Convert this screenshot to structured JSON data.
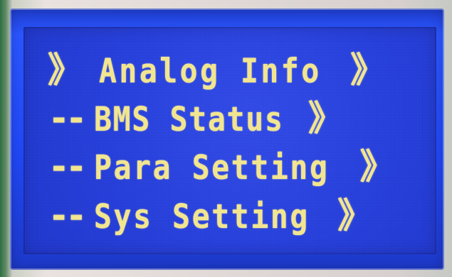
{
  "menu": {
    "items": [
      {
        "prefix": "》",
        "label": "Analog Info",
        "suffix": "》",
        "selected": true
      },
      {
        "prefix": "--",
        "label": "BMS Status",
        "suffix": "》",
        "selected": false
      },
      {
        "prefix": "--",
        "label": "Para Setting",
        "suffix": "》",
        "selected": false
      },
      {
        "prefix": "--",
        "label": "Sys Setting",
        "suffix": "》",
        "selected": false
      }
    ]
  },
  "colors": {
    "screen_background": "#2a43df",
    "text_color": "#f2e58f",
    "bezel": "#2148f7"
  },
  "icons": {
    "selection_marker": "double-chevron-right-icon",
    "submenu_indicator": "double-chevron-right-icon"
  }
}
